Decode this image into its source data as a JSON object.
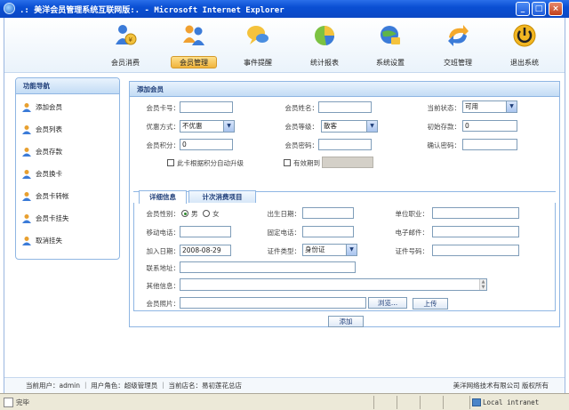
{
  "window": {
    "title": ".: 美洋会员管理系统互联网版:. - Microsoft Internet Explorer",
    "minimize": "_",
    "maximize": "□",
    "close": "×"
  },
  "topnav": {
    "items": [
      {
        "label": "会员消费",
        "icon": "member-consume-icon"
      },
      {
        "label": "会员管理",
        "icon": "member-manage-icon",
        "active": true
      },
      {
        "label": "事件提醒",
        "icon": "event-reminder-icon"
      },
      {
        "label": "统计报表",
        "icon": "statistics-report-icon"
      },
      {
        "label": "系统设置",
        "icon": "system-settings-icon"
      },
      {
        "label": "交班管理",
        "icon": "shift-handover-icon"
      },
      {
        "label": "退出系统",
        "icon": "power-icon"
      }
    ]
  },
  "sidebar": {
    "title": "功能导航",
    "items": [
      {
        "label": "添加会员"
      },
      {
        "label": "会员列表"
      },
      {
        "label": "会员存款"
      },
      {
        "label": "会员换卡"
      },
      {
        "label": "会员卡转帐"
      },
      {
        "label": "会员卡挂失"
      },
      {
        "label": "取消挂失"
      }
    ]
  },
  "form": {
    "title": "添加会员",
    "card_no_label": "会员卡号：",
    "name_label": "会员姓名：",
    "status_label": "当前状态：",
    "status_value": "可用",
    "discount_label": "优惠方式：",
    "discount_value": "不优惠",
    "level_label": "会员等级：",
    "level_value": "散客",
    "init_deposit_label": "初始存款：",
    "init_deposit_value": "0",
    "points_label": "会员积分：",
    "points_value": "0",
    "password_label": "会员密码：",
    "confirm_password_label": "确认密码：",
    "auto_upgrade_label": "此卡根据积分自动升级",
    "expiry_label": "有效期到"
  },
  "tabs": [
    {
      "label": "详细信息",
      "active": true
    },
    {
      "label": "计次消费项目",
      "active": false
    }
  ],
  "detail": {
    "gender_label": "会员性别：",
    "male": "男",
    "female": "女",
    "birthday_label": "出生日期：",
    "company_label": "单位职业：",
    "mobile_label": "移动电话：",
    "phone_label": "固定电话：",
    "email_label": "电子邮件：",
    "join_date_label": "加入日期：",
    "join_date_value": "2008-08-29",
    "id_type_label": "证件类型：",
    "id_type_value": "身份证",
    "id_no_label": "证件号码：",
    "address_label": "联系地址：",
    "other_label": "其他信息：",
    "photo_label": "会员照片：",
    "browse_button": "浏览...",
    "upload_button": "上传"
  },
  "actions": {
    "add_button": "添加"
  },
  "footer": {
    "left": "当前用户：admin ｜ 用户角色：超级管理员 ｜ 当前店名：易初莲花总店",
    "right": "美洋网络技术有限公司  版权所有"
  },
  "statusbar": {
    "status": "完毕",
    "zone": "Local intranet"
  },
  "colors": {
    "accent": "#1f3e79",
    "panel_border": "#8fb6e3",
    "active_nav": "#f0b43c"
  }
}
